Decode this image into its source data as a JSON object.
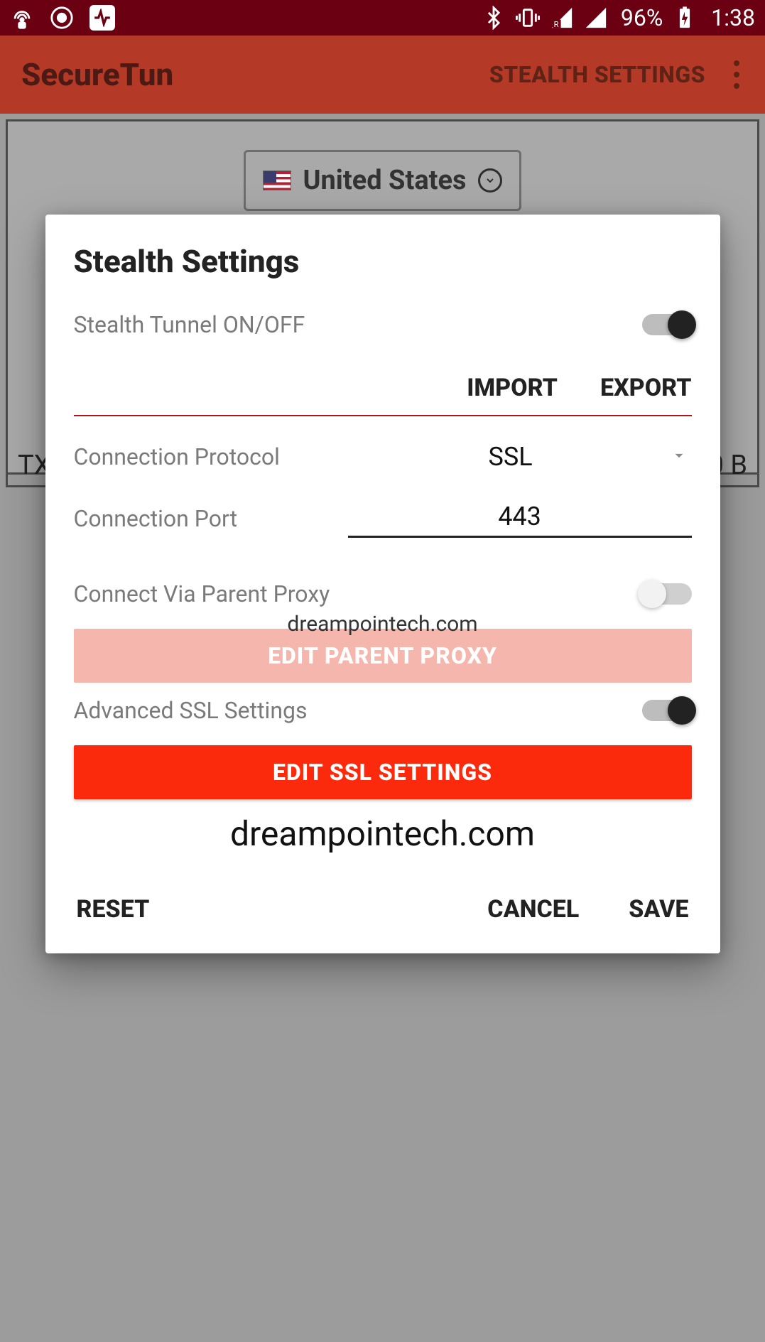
{
  "statusbar": {
    "battery_pct": "96%",
    "clock": "1:38"
  },
  "appbar": {
    "title": "SecureTun",
    "action": "STEALTH SETTINGS"
  },
  "background": {
    "country": "United States",
    "tx": "TX",
    "rx_value": "0 B"
  },
  "dialog": {
    "title": "Stealth Settings",
    "stealth_toggle_label": "Stealth Tunnel ON/OFF",
    "import_label": "IMPORT",
    "export_label": "EXPORT",
    "protocol_label": "Connection Protocol",
    "protocol_value": "SSL",
    "port_label": "Connection Port",
    "port_value": "443",
    "parent_proxy_label": "Connect Via Parent Proxy",
    "edit_parent_proxy": "EDIT PARENT PROXY",
    "advanced_ssl_label": "Advanced SSL Settings",
    "edit_ssl": "EDIT SSL SETTINGS",
    "reset": "RESET",
    "cancel": "CANCEL",
    "save": "SAVE",
    "toggles": {
      "stealth": true,
      "parent_proxy": false,
      "advanced_ssl": true
    }
  },
  "watermark": "dreampointech.com",
  "colors": {
    "statusbar_bg": "#6a0012",
    "appbar_bg": "#b43a27",
    "accent_red": "#fc2a0c",
    "accent_pink": "#f5b6ad",
    "divider_red": "#ad1616"
  }
}
